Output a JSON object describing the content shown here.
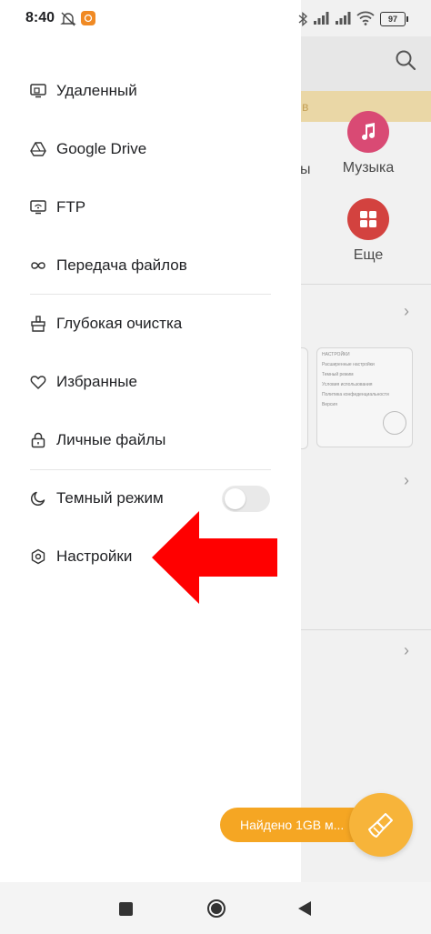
{
  "status_bar": {
    "time": "8:40",
    "battery": "97"
  },
  "drawer": {
    "items": [
      {
        "label": "Удаленный"
      },
      {
        "label": "Google Drive"
      },
      {
        "label": "FTP"
      },
      {
        "label": "Передача файлов"
      },
      {
        "label": "Глубокая очистка"
      },
      {
        "label": "Избранные"
      },
      {
        "label": "Личные файлы"
      },
      {
        "label": "Темный режим",
        "toggle_on": false
      },
      {
        "label": "Настройки"
      }
    ]
  },
  "background": {
    "banner_text": "в",
    "apps": [
      {
        "label": "ы"
      },
      {
        "label": "Музыка"
      },
      {
        "label": "Еще"
      }
    ],
    "mini_settings": {
      "header": "НАСТРОЙКИ",
      "items": [
        "Расширенные настройки",
        "Темный режим",
        "Условия использования",
        "Политика конфиденциальности",
        "Версия"
      ]
    }
  },
  "cleaner": {
    "found_text": "Найдено 1GB м..."
  },
  "colors": {
    "accent_orange": "#f5a623",
    "arrow_red": "#ff0000",
    "music_pink": "#d94a74",
    "more_red": "#d3423f"
  }
}
